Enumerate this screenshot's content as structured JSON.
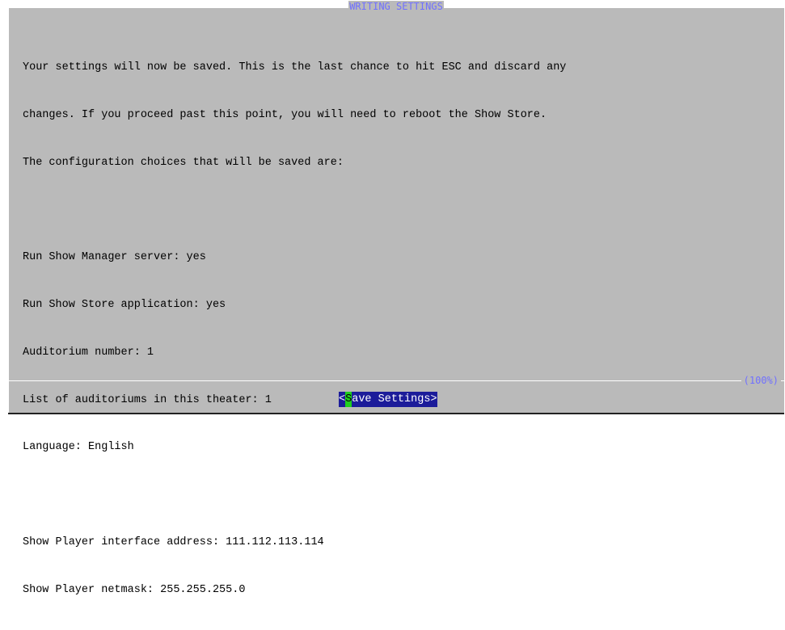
{
  "dialog": {
    "title": "WRITING SETTINGS",
    "lines": [
      "Your settings will now be saved. This is the last chance to hit ESC and discard any",
      "changes. If you proceed past this point, you will need to reboot the Show Store.",
      "The configuration choices that will be saved are:",
      "",
      "Run Show Manager server: yes",
      "Run Show Store application: yes",
      "Auditorium number: 1",
      "List of auditoriums in this theater: 1",
      "Language: English",
      "",
      "Show Player interface address: 111.112.113.114",
      "Show Player netmask: 255.255.255.0"
    ],
    "scroll_percent": "(100%)"
  },
  "button": {
    "open_bracket": "<",
    "hotkey": "S",
    "label_rest": "ave Settings",
    "close_bracket": ">"
  },
  "colors": {
    "background": "#bababa",
    "title": "#7070ff",
    "button_bg": "#1c1c9a",
    "hotkey_bg": "#1fcf1f"
  }
}
